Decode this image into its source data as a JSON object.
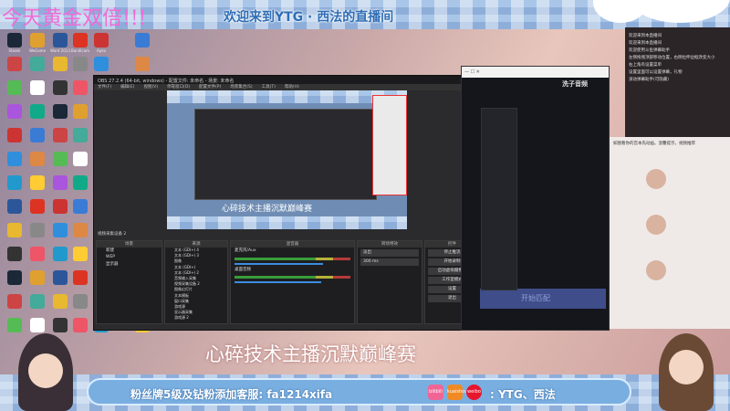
{
  "banner": {
    "gold_text": "今天黄金双倍!!!",
    "welcome": "欢迎来到YTG · 西法的直播间"
  },
  "desktop_icons": [
    {
      "name": "Steam",
      "color": "#1b2838"
    },
    {
      "name": "WeGame",
      "color": "#e0a030"
    },
    {
      "name": "Word 2013",
      "color": "#2b579a"
    },
    {
      "name": "Bandicam",
      "color": "#d32"
    },
    {
      "name": "Apex",
      "color": "#c33"
    },
    {
      "name": "",
      "color": "#3a7bd5"
    },
    {
      "name": "",
      "color": "#c44"
    },
    {
      "name": "",
      "color": "#4a9"
    },
    {
      "name": "",
      "color": "#e8b830"
    },
    {
      "name": "",
      "color": "#888"
    },
    {
      "name": "",
      "color": "#2f8fdd"
    },
    {
      "name": "",
      "color": "#d84"
    },
    {
      "name": "",
      "color": "#5b5"
    },
    {
      "name": "",
      "color": "#fff"
    },
    {
      "name": "",
      "color": "#333"
    },
    {
      "name": "",
      "color": "#e56"
    },
    {
      "name": "",
      "color": "#29c"
    },
    {
      "name": "",
      "color": "#fc3"
    },
    {
      "name": "",
      "color": "#a5d"
    },
    {
      "name": "",
      "color": "#1a8"
    }
  ],
  "obs": {
    "title": "OBS 27.2.4 (64-bit, windows) - 配置文件: 未命名 - 场景: 未命名",
    "menu": [
      "文件(F)",
      "编辑(E)",
      "视图(V)",
      "停靠窗口(D)",
      "配置文件(P)",
      "场景集合(S)",
      "工具(T)",
      "帮助(H)"
    ],
    "preview_caption": "心碎技术主播沉默巅峰赛",
    "scene_bar": "视频采集设备 2",
    "docks": {
      "scenes": "场景",
      "sources": "来源",
      "mixer": "混音器",
      "transitions": "转场特效",
      "controls": "控件"
    },
    "scenes": [
      "新建",
      "WEP",
      "显示器"
    ],
    "sources": [
      "文本 (GDI+) 4",
      "文本 (GDI+) 3",
      "图像",
      "文本 (GDI+)",
      "文本 (GDI+) 2",
      "音频输入采集",
      "视频采集设备 2",
      "图像幻灯片",
      "文本模板",
      "窗口采集",
      "游戏源",
      "显示器采集",
      "游戏源 2"
    ],
    "mixer": [
      {
        "name": "麦克风/Aux",
        "level": 0.72
      },
      {
        "name": "桌面音频",
        "level": 0.7
      }
    ],
    "transition": {
      "type": "淡出",
      "duration": "300 ms"
    },
    "controls": [
      "停止推流",
      "开始录制",
      "启动虚拟摄像机",
      "工作室模式",
      "设置",
      "退出"
    ]
  },
  "music": {
    "brand": "洗子音频",
    "match_button": "开始匹配"
  },
  "chat": {
    "lines": [
      "欢迎来到本直播间",
      "欢迎来到本直播间",
      "欢迎使用斗鱼弹幕助手",
      "左侧拖拽顶部移动位置，右侧拉伸边框改变大小",
      "右上角有设置菜单",
      "设置里面可以设置弹幕，礼物",
      "滚动弹幕助手(可隐藏)"
    ]
  },
  "side_panel": {
    "text": "如图看你的宫本先动画。温馨提示，视频推荐"
  },
  "caption": "心碎技术主播沉默巅峰赛",
  "footer": {
    "fans": "粉丝牌5级及钻粉添加客服: fa1214xifa",
    "platforms": [
      "bilibili",
      "kuaishou",
      "weibo"
    ],
    "handle": ": YTG、西法"
  }
}
